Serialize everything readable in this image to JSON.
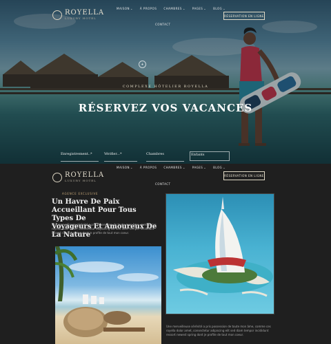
{
  "brand": {
    "name": "ROYELLA",
    "tagline": "LUXURY HOTEL"
  },
  "nav": {
    "items": [
      {
        "label": "MAISON",
        "caret": "⌄"
      },
      {
        "label": "À PROPOS",
        "caret": ""
      },
      {
        "label": "CHAMBRES",
        "caret": "⌄"
      },
      {
        "label": "PAGES",
        "caret": "⌄"
      },
      {
        "label": "BLOG",
        "caret": "⌄"
      }
    ],
    "contact": "CONTACT",
    "book_label": "RÉSERVATION EN LIGNE"
  },
  "hero": {
    "kicker": "COMPLEXE HÔTELIER ROYELLA",
    "title": "RÉSERVEZ VOS VACANCES",
    "play_icon": "+",
    "fields": [
      {
        "label": "Enregistrement..*"
      },
      {
        "label": "Vérifier...*"
      },
      {
        "label": "Chambres"
      },
      {
        "label": "Enfants"
      }
    ]
  },
  "about": {
    "kicker": "AGENCE EXCLUSIVE",
    "title_lines": [
      "Un Havre De Paix Accueillant Pour Tous",
      "Types De",
      "Voyageurs Et Amoureux De La Nature"
    ],
    "paragraph_lines": [
      "Une merveilleuse sérénité a pris possession de toute mon âme, comme ces",
      "royella dolor amet, consectetur adipiscing elit sed diam tempor incididunt",
      "ressort newest spring dont je profite de tout mon coeur."
    ],
    "paragraph2_lines": [
      "Une merveilleuse sérénité a pris possession de toute mon âme, comme ces",
      "royella dolor amet, consectetur adipiscing elit sed diam tempor incididunt",
      "ressort newest spring dont je profite de tout mon coeur."
    ]
  },
  "colors": {
    "accent": "#c9a97a",
    "background": "#1f1f1f"
  }
}
